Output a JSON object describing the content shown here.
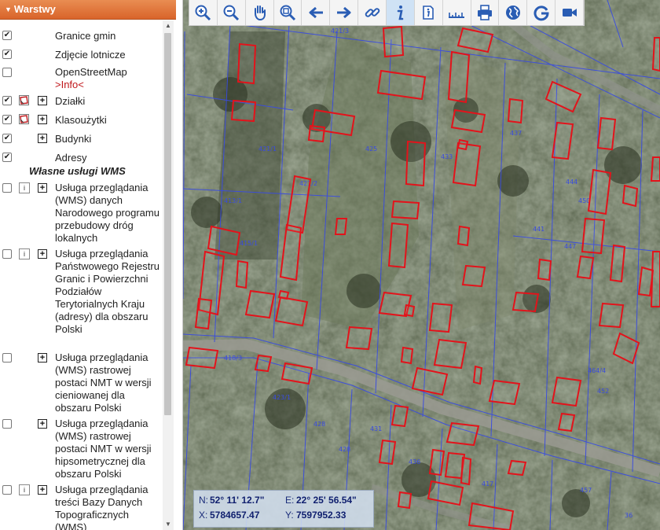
{
  "panel": {
    "title": "Warstwy",
    "layers": [
      {
        "label": "Granice gmin",
        "checked": true
      },
      {
        "label": "Zdjęcie lotnicze",
        "checked": true
      },
      {
        "label": "OpenStreetMap",
        "link": ">Info<",
        "checked": false
      },
      {
        "label": "Działki",
        "checked": true
      },
      {
        "label": "Klasoużytki",
        "checked": true
      },
      {
        "label": "Budynki",
        "checked": true
      },
      {
        "label": "Adresy",
        "checked": true
      }
    ],
    "wms_group_title": "Własne usługi WMS",
    "wms_services": [
      {
        "label": "Usługa przeglądania (WMS) danych Narodowego programu przebudowy dróg lokalnych",
        "checked": false
      },
      {
        "label": "Usługa przeglądania Państwowego Rejestru Granic i Powierzchni Podziałów Terytorialnych Kraju (adresy) dla obszaru Polski",
        "checked": false
      },
      {
        "label": "Usługa przeglądania (WMS) rastrowej postaci NMT w wersji cieniowanej dla obszaru Polski",
        "checked": false
      },
      {
        "label": "Usługa przeglądania (WMS) rastrowej postaci NMT w wersji hipsometrycznej dla obszaru Polski",
        "checked": false
      },
      {
        "label": "Usługa przeglądania treści Bazy Danych Topograficznych (WMS)",
        "checked": false
      }
    ]
  },
  "toolbar": {
    "tools": [
      "zoom-in-icon",
      "zoom-out-icon",
      "pan-hand-icon",
      "zoom-extent-icon",
      "back-arrow-icon",
      "forward-arrow-icon",
      "link-icon",
      "info-icon",
      "identify-icon",
      "measure-ruler-icon",
      "print-icon",
      "globe-icon",
      "google-icon",
      "video-icon"
    ],
    "active_tool": "info-icon"
  },
  "coordinates": {
    "n_label": "N:",
    "n_value": "52° 11' 12.7\"",
    "e_label": "E:",
    "e_value": "22° 25' 56.54\"",
    "x_label": "X:",
    "x_value": "5784657.47",
    "y_label": "Y:",
    "y_value": "7597952.33"
  },
  "map": {
    "parcel_labels": [
      "421/3",
      "421/2",
      "421/1",
      "425",
      "433",
      "437",
      "441",
      "444",
      "450",
      "447",
      "413/1",
      "415/1",
      "418/3",
      "423/1",
      "428",
      "428",
      "431",
      "436",
      "417",
      "457",
      "464/4",
      "452",
      "36"
    ],
    "colors": {
      "parcel_line": "#3a4ce0",
      "building_outline": "#e3131b",
      "road": "#9a9a92"
    }
  }
}
